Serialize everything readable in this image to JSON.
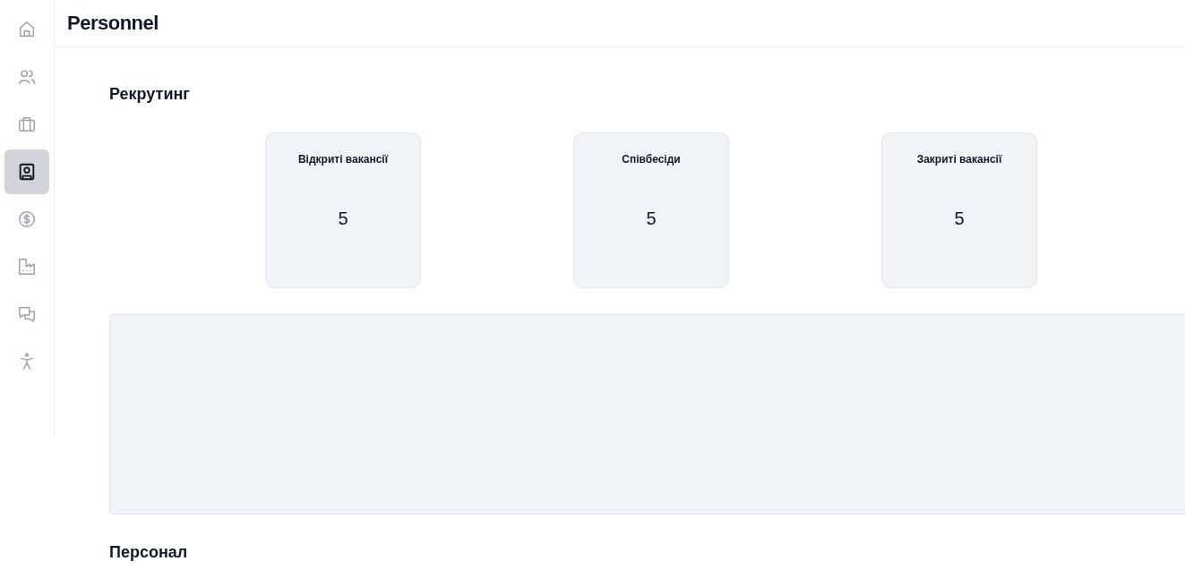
{
  "sidebar": {
    "items": [
      {
        "selected": false
      },
      {
        "selected": false
      },
      {
        "selected": false
      },
      {
        "selected": true
      },
      {
        "selected": false
      },
      {
        "selected": false
      },
      {
        "selected": false
      },
      {
        "selected": false
      }
    ]
  },
  "header": {
    "title": "Personnel"
  },
  "sections": [
    {
      "title": "Рекрутинг",
      "cards": [
        {
          "label": "Відкриті вакансії",
          "value": "5"
        },
        {
          "label": "Співбесіди",
          "value": "5"
        },
        {
          "label": "Закриті вакансії",
          "value": "5"
        }
      ]
    },
    {
      "title": "Персонал"
    }
  ]
}
